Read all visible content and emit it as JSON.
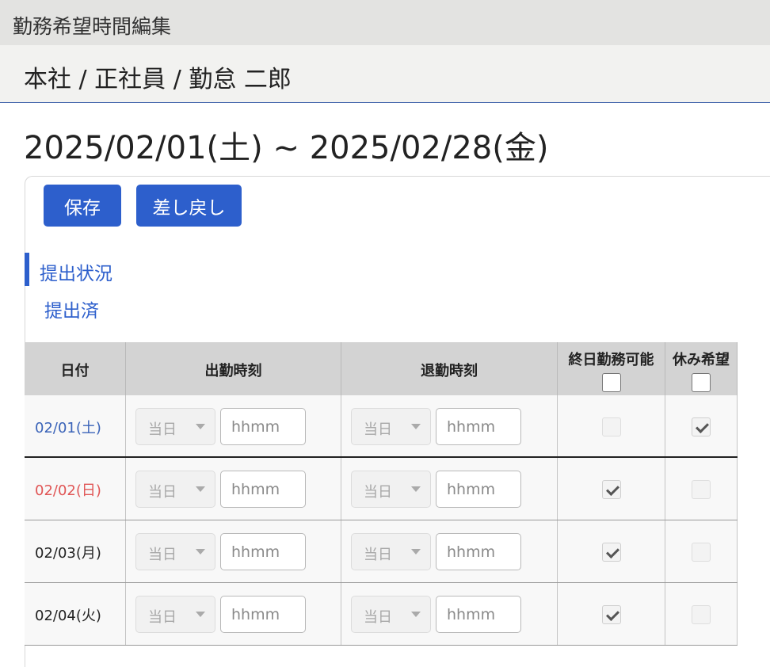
{
  "window": {
    "title": "勤務希望時間編集"
  },
  "breadcrumb": "本社 / 正社員 / 勤怠 二郎",
  "period": "2025/02/01(土) ~ 2025/02/28(金)",
  "buttons": {
    "save": "保存",
    "return": "差し戻し"
  },
  "status": {
    "label": "提出状況",
    "value": "提出済"
  },
  "table": {
    "headers": {
      "date": "日付",
      "start": "出勤時刻",
      "end": "退勤時刻",
      "all_day": "終日勤務可能",
      "day_off": "休み希望"
    },
    "select_default": "当日",
    "time_placeholder": "hhmm",
    "rows": [
      {
        "date": "02/01(土)",
        "day_type": "saturday",
        "all_day": false,
        "day_off": true
      },
      {
        "date": "02/02(日)",
        "day_type": "sunday",
        "all_day": true,
        "day_off": false
      },
      {
        "date": "02/03(月)",
        "day_type": "weekday",
        "all_day": true,
        "day_off": false
      },
      {
        "date": "02/04(火)",
        "day_type": "weekday",
        "all_day": true,
        "day_off": false
      }
    ]
  },
  "colors": {
    "accent": "#2d5fcc",
    "saturday": "#3a63b8",
    "sunday": "#e05555"
  }
}
